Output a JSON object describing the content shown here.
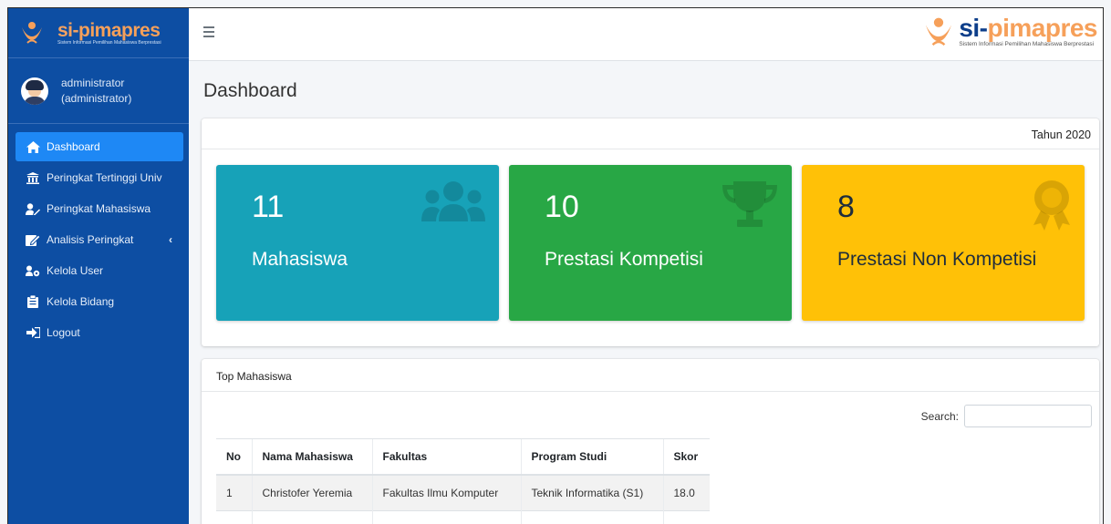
{
  "brand": {
    "si": "si-",
    "name": "pimapres",
    "subtitle": "Sistem Informasi Pemilihan Mahasiswa Berprestasi"
  },
  "user": {
    "name": "administrator",
    "role": "(administrator)"
  },
  "sidebar": {
    "items": [
      {
        "label": "Dashboard",
        "icon": "home-icon",
        "active": true
      },
      {
        "label": "Peringkat Tertinggi Univ",
        "icon": "university-icon"
      },
      {
        "label": "Peringkat Mahasiswa",
        "icon": "user-edit-icon"
      },
      {
        "label": "Analisis Peringkat",
        "icon": "chart-edit-icon",
        "caret": "‹"
      },
      {
        "label": "Kelola User",
        "icon": "users-cog-icon"
      },
      {
        "label": "Kelola Bidang",
        "icon": "clipboard-icon"
      },
      {
        "label": "Logout",
        "icon": "sign-out-icon"
      }
    ]
  },
  "page": {
    "title": "Dashboard",
    "year": "Tahun 2020"
  },
  "stats": [
    {
      "value": "11",
      "label": "Mahasiswa",
      "icon": "users-icon",
      "color": "#17a2b8"
    },
    {
      "value": "10",
      "label": "Prestasi Kompetisi",
      "icon": "trophy-icon",
      "color": "#28a745"
    },
    {
      "value": "8",
      "label": "Prestasi Non Kompetisi",
      "icon": "award-icon",
      "color": "#ffc107"
    }
  ],
  "table": {
    "title": "Top Mahasiswa",
    "search_label": "Search:",
    "search_value": "",
    "columns": [
      "No",
      "Nama Mahasiswa",
      "Fakultas",
      "Program Studi",
      "Skor"
    ],
    "rows": [
      [
        "1",
        "Christofer Yeremia",
        "Fakultas Ilmu Komputer",
        "Teknik Informatika (S1)",
        "18.0"
      ]
    ]
  },
  "colors": {
    "sidebar": "#0d4ea3",
    "active": "#1e88f5",
    "brand_orange": "#f6a05a"
  }
}
